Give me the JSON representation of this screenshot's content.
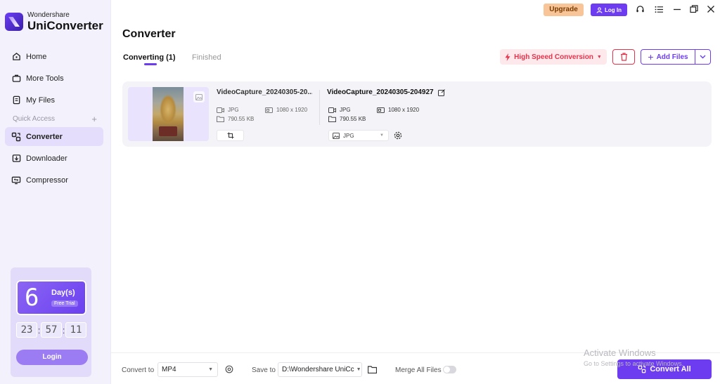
{
  "app": {
    "brand": "Wondershare",
    "product": "UniConverter"
  },
  "sidebar": {
    "items": [
      {
        "label": "Home",
        "icon": "home-icon"
      },
      {
        "label": "More Tools",
        "icon": "toolbox-icon"
      },
      {
        "label": "My Files",
        "icon": "files-icon"
      }
    ],
    "quick_access_label": "Quick Access",
    "quick_items": [
      {
        "label": "Converter",
        "icon": "converter-icon",
        "active": true
      },
      {
        "label": "Downloader",
        "icon": "downloader-icon"
      },
      {
        "label": "Compressor",
        "icon": "compressor-icon"
      }
    ],
    "trial": {
      "days": "6",
      "unit": "Day(s)",
      "subtitle": "Free Trial",
      "hours": "23",
      "minutes": "57",
      "seconds": "11",
      "login_label": "Login"
    }
  },
  "topbar": {
    "upgrade_label": "Upgrade",
    "login_label": "Log In"
  },
  "main": {
    "title": "Converter",
    "tabs": [
      {
        "label": "Converting (1)",
        "active": true
      },
      {
        "label": "Finished",
        "active": false
      }
    ],
    "high_speed_label": "High Speed Conversion",
    "add_files_label": "Add Files"
  },
  "file": {
    "source": {
      "name": "VideoCapture_20240305-20...",
      "format": "JPG",
      "resolution": "1080 x 1920",
      "size": "790.55 KB"
    },
    "target": {
      "name": "VideoCapture_20240305-204927",
      "format": "JPG",
      "resolution": "1080 x 1920",
      "size": "790.55 KB",
      "output_format": "JPG"
    }
  },
  "bottom": {
    "convert_to_label": "Convert to",
    "convert_to_value": "MP4",
    "save_to_label": "Save to",
    "save_to_value": "D:\\Wondershare UniCc",
    "merge_label": "Merge All Files",
    "merge_enabled": false,
    "convert_all_label": "Convert All"
  },
  "watermark": {
    "title": "Activate Windows",
    "subtitle": "Go to Settings to activate Windows."
  },
  "colors": {
    "accent": "#6e3cf0",
    "danger": "#e5334b",
    "upgrade": "#f7c598",
    "sidebar_bg": "#f3f1fb"
  }
}
